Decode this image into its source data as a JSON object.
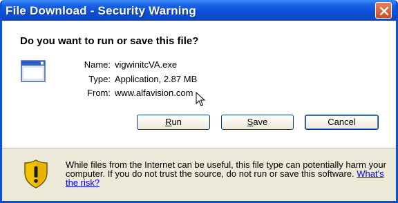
{
  "window": {
    "title": "File Download - Security Warning"
  },
  "dialog": {
    "question": "Do you want to run or save this file?",
    "file_icon": "application-window-icon",
    "fields": [
      {
        "label": "Name:",
        "value": "vigwinitcVA.exe"
      },
      {
        "label": "Type:",
        "value": "Application, 2.87 MB"
      },
      {
        "label": "From:",
        "value": "www.alfavision.com"
      }
    ],
    "buttons": {
      "run": {
        "prefix": "",
        "accel": "R",
        "rest": "un"
      },
      "save": {
        "prefix": "",
        "accel": "S",
        "rest": "ave"
      },
      "cancel": {
        "label": "Cancel"
      }
    }
  },
  "warning": {
    "icon": "shield-warning-icon",
    "text": "While files from the Internet can be useful, this file type can potentially harm your computer. If you do not trust the source, do not run or save this software. ",
    "link": "What's the risk?"
  },
  "colors": {
    "titlebar": "#0a4fd6",
    "dialog_bg": "#ece9d8",
    "close_button": "#d14a1f",
    "link": "#0000ff"
  }
}
